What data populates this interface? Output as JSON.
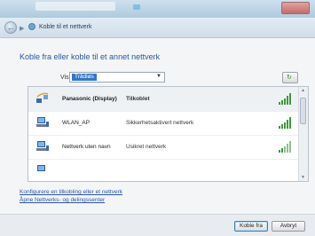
{
  "navbar": {
    "title": "Koble til et nettverk",
    "back_icon": "back-arrow-icon"
  },
  "main": {
    "heading": "Koble fra eller koble til et annet nettverk",
    "show_label": "Vis",
    "show_value": "Trådløs"
  },
  "networks": [
    {
      "name": "Panasonic (Display)",
      "status": "Tilkoblet",
      "selected": true,
      "icon": "wireless-network-icon"
    },
    {
      "name": "WLAN_AP",
      "status": "Sikkerhetsaktivert nettverk",
      "selected": false,
      "icon": "computer-network-icon"
    },
    {
      "name": "Nettverk uten navn",
      "status": "Usikret nettverk",
      "selected": false,
      "icon": "computer-network-icon"
    }
  ],
  "links": {
    "setup": "Konfigurere en tilkobling eller et nettverk",
    "center": "Åpne Nettverks- og delingssenter"
  },
  "buttons": {
    "connect": "Koble fra",
    "cancel": "Avbryt"
  },
  "colors": {
    "accent": "#2a57a3",
    "signal": "#3d9a3d",
    "selection": "#3477c6"
  }
}
